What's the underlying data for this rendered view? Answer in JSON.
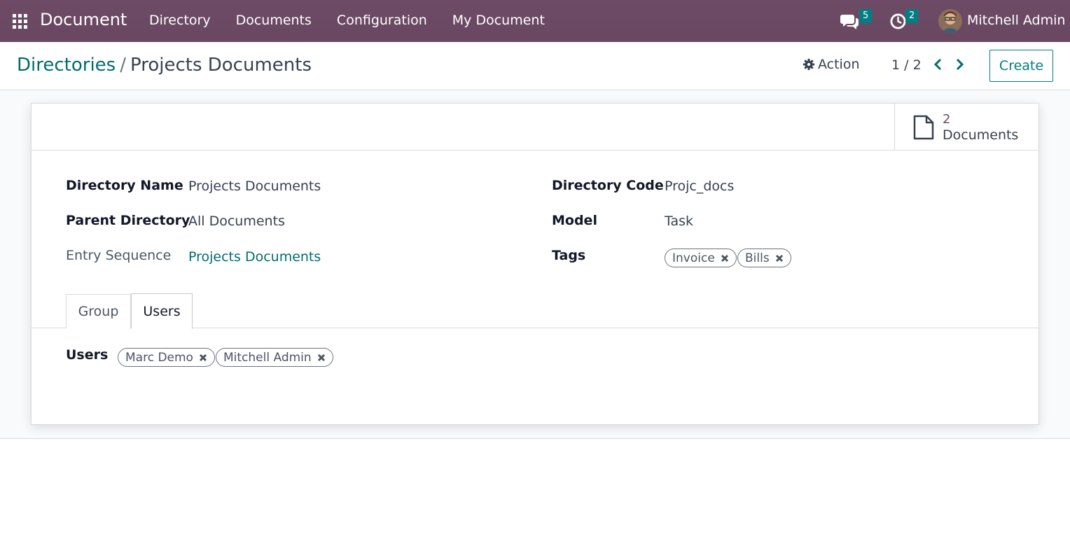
{
  "navbar": {
    "app_title": "Document",
    "menu": [
      "Directory",
      "Documents",
      "Configuration",
      "My Document"
    ],
    "messages_count": "5",
    "activities_count": "2",
    "user_name": "Mitchell Admin",
    "bg_color": "#6d4a65"
  },
  "control_panel": {
    "breadcrumb_parent": "Directories",
    "breadcrumb_separator": "/",
    "breadcrumb_current": "Projects Documents",
    "action_label": "Action",
    "pager_value": "1 / 2",
    "create_label": "Create"
  },
  "smart_button": {
    "count": "2",
    "label": "Documents"
  },
  "fields": {
    "directory_name_label": "Directory Name",
    "directory_name_value": "Projects Documents",
    "parent_directory_label": "Parent Directory",
    "parent_directory_value": "All Documents",
    "entry_sequence_label": "Entry Sequence",
    "entry_sequence_value": "Projects Documents",
    "directory_code_label": "Directory Code",
    "directory_code_value": "Projc_docs",
    "model_label": "Model",
    "model_value": "Task",
    "tags_label": "Tags",
    "tags": [
      "Invoice",
      "Bills"
    ]
  },
  "tabs": [
    "Group",
    "Users"
  ],
  "users_tab": {
    "label": "Users",
    "users": [
      "Marc Demo",
      "Mitchell Admin"
    ]
  },
  "colors": {
    "accent": "#017e84",
    "link": "#016c6e",
    "brand": "#714b67"
  }
}
